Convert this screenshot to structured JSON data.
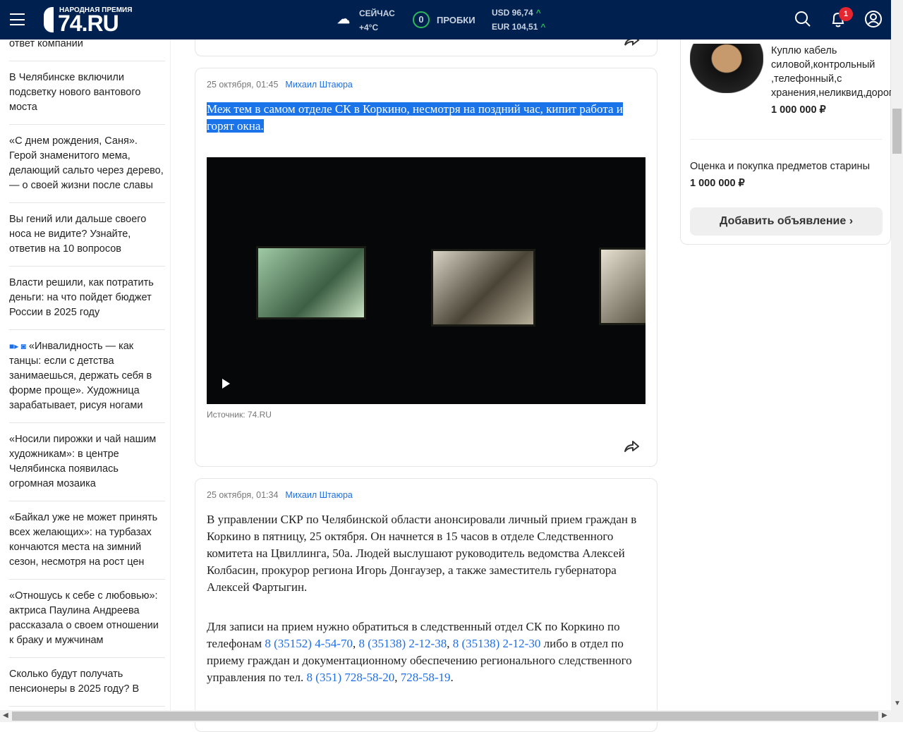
{
  "header": {
    "logo_prize": "НАРОДНАЯ ПРЕМИЯ",
    "logo_name": "74.RU",
    "weather_label": "СЕЙЧАС",
    "weather_temp": "+4°C",
    "traffic_score": "0",
    "traffic_label": "ПРОБКИ",
    "usd": "USD 96,74",
    "eur": "EUR 104,51",
    "notifications": "1"
  },
  "left_news": [
    "ответ компании",
    "В Челябинске включили подсветку нового вантового моста",
    "«С днем рождения, Саня». Герой знаменитого мема, делающий сальто через дерево, — о своей жизни после славы",
    "Вы гений или дальше своего носа не видите? Узнайте, ответив на 10 вопросов",
    "Власти решили, как потратить деньги: на что пойдет бюджет России в 2025 году",
    "«Инвалидность — как танцы: если с детства занимаешься, держать себя в форме проще». Художница зарабатывает, рисуя ногами",
    "«Носили пирожки и чай нашим художникам»: в центре Челябинска появилась огромная мозаика",
    "«Байкал уже не может принять всех желающих»: на турбазах кончаются места на зимний сезон, несмотря на рост цен",
    "«Отношусь к себе с любовью»: актриса Паулина Андреева рассказала о своем отношении к браку и мужчинам",
    "Сколько будут получать пенсионеры в 2025 году? В"
  ],
  "posts": [
    {
      "date": "25 октября, 01:45",
      "author": "Михаил Штаюра",
      "headline": "Меж тем в самом отделе СК в Коркино, несмотря на поздний час, кипит работа и горят окна.",
      "source": "Источник: 74.RU"
    },
    {
      "date": "25 октября, 01:34",
      "author": "Михаил Штаюра",
      "p1": "В управлении СКР по Челябинской области анонсировали личный прием граждан в Коркино в пятницу, 25 октября. Он начнется в 15 часов в отделе Следственного комитета на Цвиллинга, 50а. Людей выслушают руководитель ведомства Алексей Колбасин, прокурор региона Игорь Донгаузер, а также заместитель губернатора Алексей Фартыгин.",
      "p2a": "Для записи на прием нужно обратиться в следственный отдел СК по Коркино по телефонам ",
      "ph1": "8 (35152) 4-54-70",
      "c1": ", ",
      "ph2": "8 (35138) 2-12-38",
      "c2": ", ",
      "ph3": "8 (35138) 2-12-30",
      "p2b": " либо в отдел по приему граждан и документационному обеспечению регионального следственного управления по тел. ",
      "ph4": "8 (351) 728-58-20",
      "c3": ", ",
      "ph5": "728-58-19",
      "end": "."
    }
  ],
  "ads": {
    "ad1_title": "Куплю кабель силовой,контрольный ,телефонный,с хранения,неликвид,дорого",
    "ad1_price": "1 000 000 ₽",
    "ad2_title": "Оценка и покупка предметов старины",
    "ad2_price": "1 000 000 ₽",
    "add_button": "Добавить объявление"
  }
}
